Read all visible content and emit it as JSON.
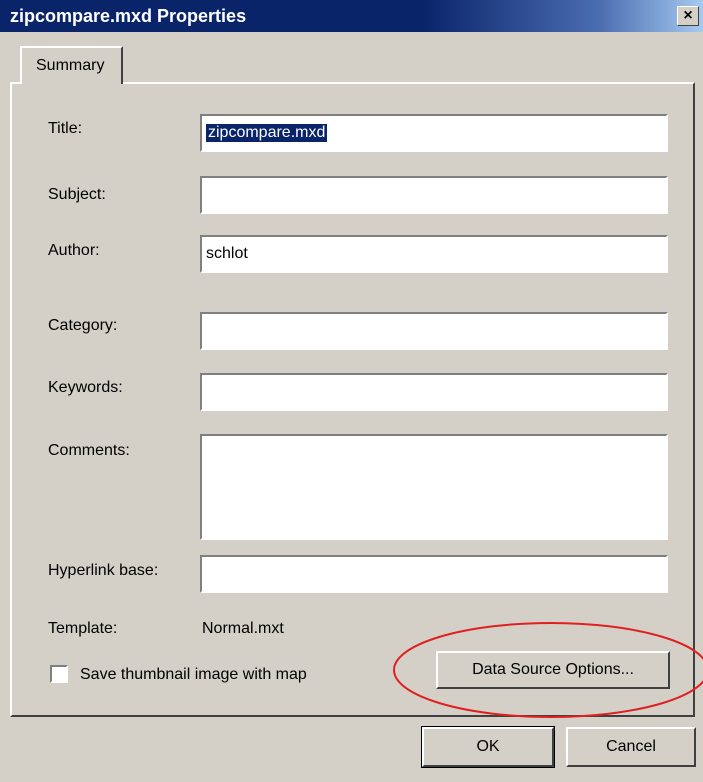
{
  "window": {
    "title": "zipcompare.mxd Properties",
    "close_glyph": "×"
  },
  "tabs": [
    {
      "label": "Summary",
      "active": true
    }
  ],
  "form": {
    "title_label": "Title:",
    "title_value": "zipcompare.mxd",
    "subject_label": "Subject:",
    "subject_value": "",
    "author_label": "Author:",
    "author_value": "schlot",
    "category_label": "Category:",
    "category_value": "",
    "keywords_label": "Keywords:",
    "keywords_value": "",
    "comments_label": "Comments:",
    "comments_value": "",
    "hyperlink_label": "Hyperlink base:",
    "hyperlink_value": "",
    "template_label": "Template:",
    "template_value": "Normal.mxt",
    "thumbnail_label": "Save thumbnail image with map",
    "thumbnail_checked": false
  },
  "buttons": {
    "data_source": "Data Source Options...",
    "ok": "OK",
    "cancel": "Cancel"
  },
  "colors": {
    "title_bar": "#0a246a",
    "dialog_bg": "#d4d0c8",
    "annotation": "#e02020"
  },
  "icons": {
    "close": "close-icon"
  }
}
